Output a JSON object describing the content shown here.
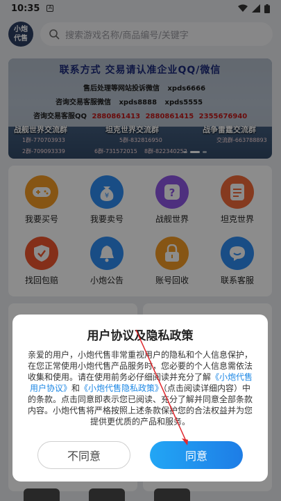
{
  "status": {
    "time": "10:35",
    "a_icon": "A"
  },
  "header": {
    "logo_line1": "小炮",
    "logo_line2": "代售",
    "search_placeholder": "搜索游戏名称/商品编号/关键字"
  },
  "banner": {
    "title": "联系方式 交易请认准企业QQ/微信",
    "line1_label": "售后处理等网站投诉微信",
    "line1_value": "xpds6666",
    "line2_label": "咨询交易客服微信",
    "line2_value_a": "xpds8888",
    "line2_value_b": "xpds5555",
    "line3_label": "咨询交易客服QQ",
    "line3_value_a": "2880861413",
    "line3_value_b": "2880861415",
    "line3_value_c": "2355676940",
    "group1": "战舰世界交流群",
    "group1_a": "1群-770703933",
    "group1_b": "2群-709093339",
    "group2": "坦克世界交流群",
    "group2_a": "5群-832816950",
    "group2_b": "6群-731572015",
    "group2_c": "8群-822340252",
    "group3": "战争雷霆交流群",
    "group3_a": "交流群-663788893"
  },
  "grid": [
    {
      "label": "我要买号",
      "icon": "gamepad-icon",
      "color": "#f59b25"
    },
    {
      "label": "我要卖号",
      "icon": "money-bag-icon",
      "color": "#2f8cf2"
    },
    {
      "label": "战舰世界",
      "icon": "question-icon",
      "color": "#8e57e6"
    },
    {
      "label": "坦克世界",
      "icon": "document-icon",
      "color": "#f26a3a"
    },
    {
      "label": "找回包赔",
      "icon": "shield-check-icon",
      "color": "#f0572f"
    },
    {
      "label": "小炮公告",
      "icon": "bell-icon",
      "color": "#2f8cf2"
    },
    {
      "label": "账号回收",
      "icon": "lock-icon",
      "color": "#f59b25"
    },
    {
      "label": "联系客服",
      "icon": "chat-icon",
      "color": "#2f8cf2"
    }
  ],
  "dialog": {
    "title": "用户协议及隐私政策",
    "p1": "亲爱的用户，小炮代售非常重视用户的隐私和个人信息保护，在您正常使用小炮代售产品服务时，您必要的个人信息需依法收集和使用。请在使用前务必仔细阅读并充分了解",
    "link1": "《小炮代售用户协议》",
    "and": "和",
    "link2": "《小炮代售隐私政策》",
    "p2": "（点击阅读详细内容）中的条款。点击同意即表示您已阅读、充分了解并同意全部条款内容。小炮代售将严格按照上述条款保护您的合法权益并为您提供更优质的产品和服务。",
    "decline": "不同意",
    "agree": "同意"
  }
}
